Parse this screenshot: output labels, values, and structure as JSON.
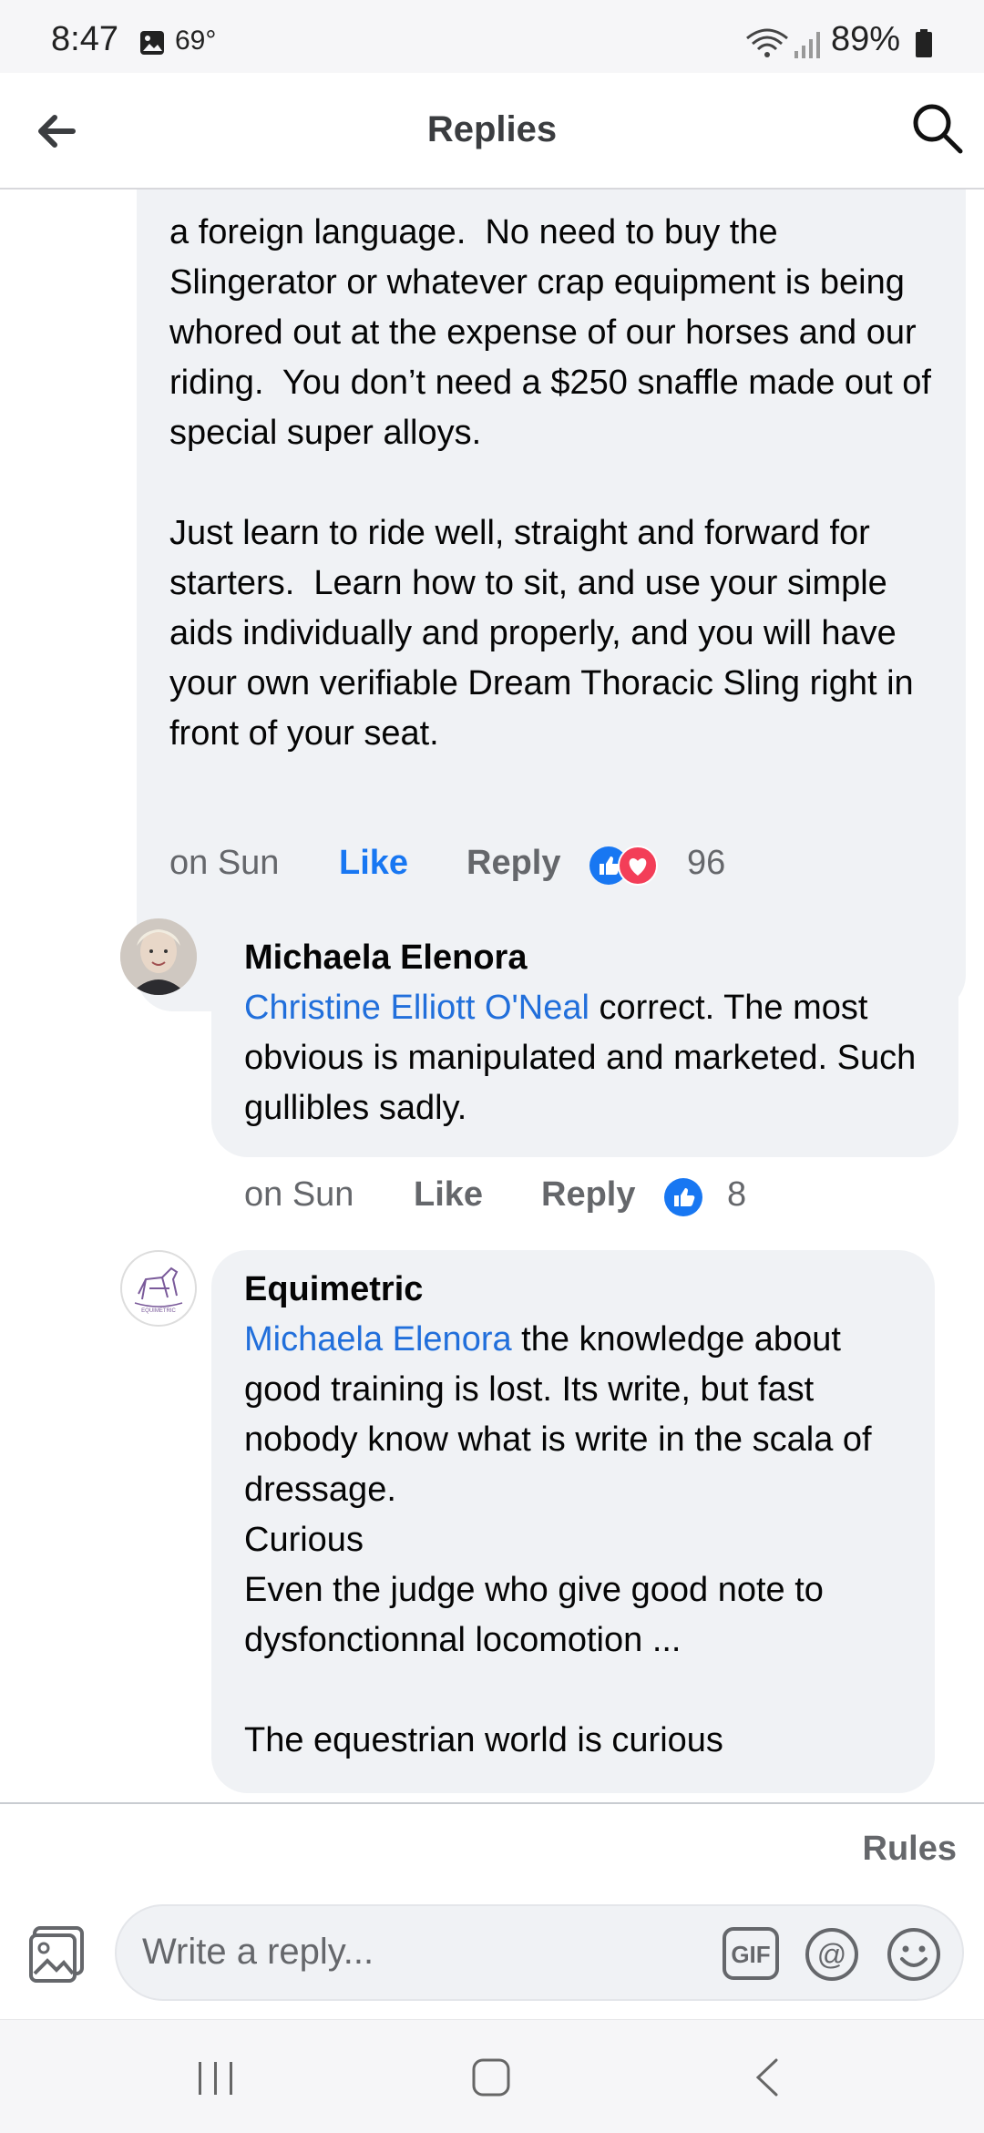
{
  "status_bar": {
    "time": "8:47",
    "temperature": "69°",
    "battery": "89%"
  },
  "header": {
    "title": "Replies"
  },
  "comments": [
    {
      "text": "a foreign language.  No need to buy the Slingerator or whatever crap equipment is being whored out at the expense of our horses and our riding.  You don’t need a $250 snaffle made out of special super alloys.\n\nJust learn to ride well, straight and forward for starters.  Learn how to sit, and use your simple aids individually and properly, and you will have your own verifiable Dream Thoracic Sling right in front of your seat.",
      "time": "on Sun",
      "like_label": "Like",
      "reply_label": "Reply",
      "reaction_count": "96",
      "reactions": [
        "like-icon",
        "love-icon"
      ]
    },
    {
      "author": "Michaela Elenora",
      "mention": "Christine Elliott O'Neal",
      "text": " correct. The most obvious is manipulated and marketed. Such gullibles sadly.",
      "time": "on Sun",
      "like_label": "Like",
      "reply_label": "Reply",
      "reaction_count": "8",
      "reactions": [
        "like-icon"
      ]
    },
    {
      "author": "Equimetric",
      "mention": "Michaela Elenora",
      "text": " the knowledge about good training is lost. Its write, but fast nobody know what is write in the scala of dressage.\nCurious\nEven the judge who give good note to dysfonctionnal locomotion ...\n\nThe equestrian world is curious",
      "avatar_logo_text": "EQUIMETRIC"
    }
  ],
  "composer": {
    "rules_label": "Rules",
    "placeholder": "Write a reply..."
  },
  "colors": {
    "accent": "#1877f2",
    "mention": "#216fdb",
    "bubble": "#f0f2f5",
    "love": "#f33e58"
  }
}
